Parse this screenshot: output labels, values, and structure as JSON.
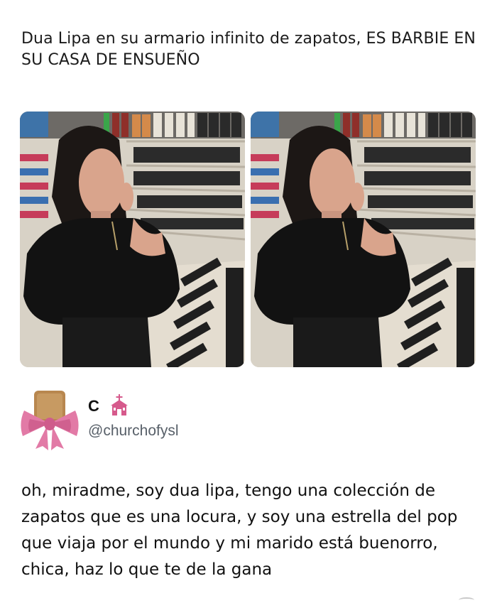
{
  "post": {
    "caption": "Dua Lipa en su armario infinito de zapatos, ES BARBIE EN SU CASA DE ENSUEÑO",
    "photos": [
      {
        "icon": "photo-shoe-closet-selfie"
      },
      {
        "icon": "photo-shoe-closet-selfie"
      }
    ]
  },
  "tweet": {
    "display_name": "C",
    "name_emoji_icon": "church-icon",
    "handle": "@churchofysl",
    "avatar_icon": "pink-bow-avatar",
    "text": "oh, miradme, soy dua lipa, tengo una colección de zapatos que es una locura, y soy una estrella del pop que viaja por el mundo y mi marido está buenorro, chica, haz lo que te de la gana"
  },
  "colors": {
    "background": "#ffffff",
    "text": "#111111",
    "handle": "#586069",
    "bow_pink": "#e27aa6"
  }
}
